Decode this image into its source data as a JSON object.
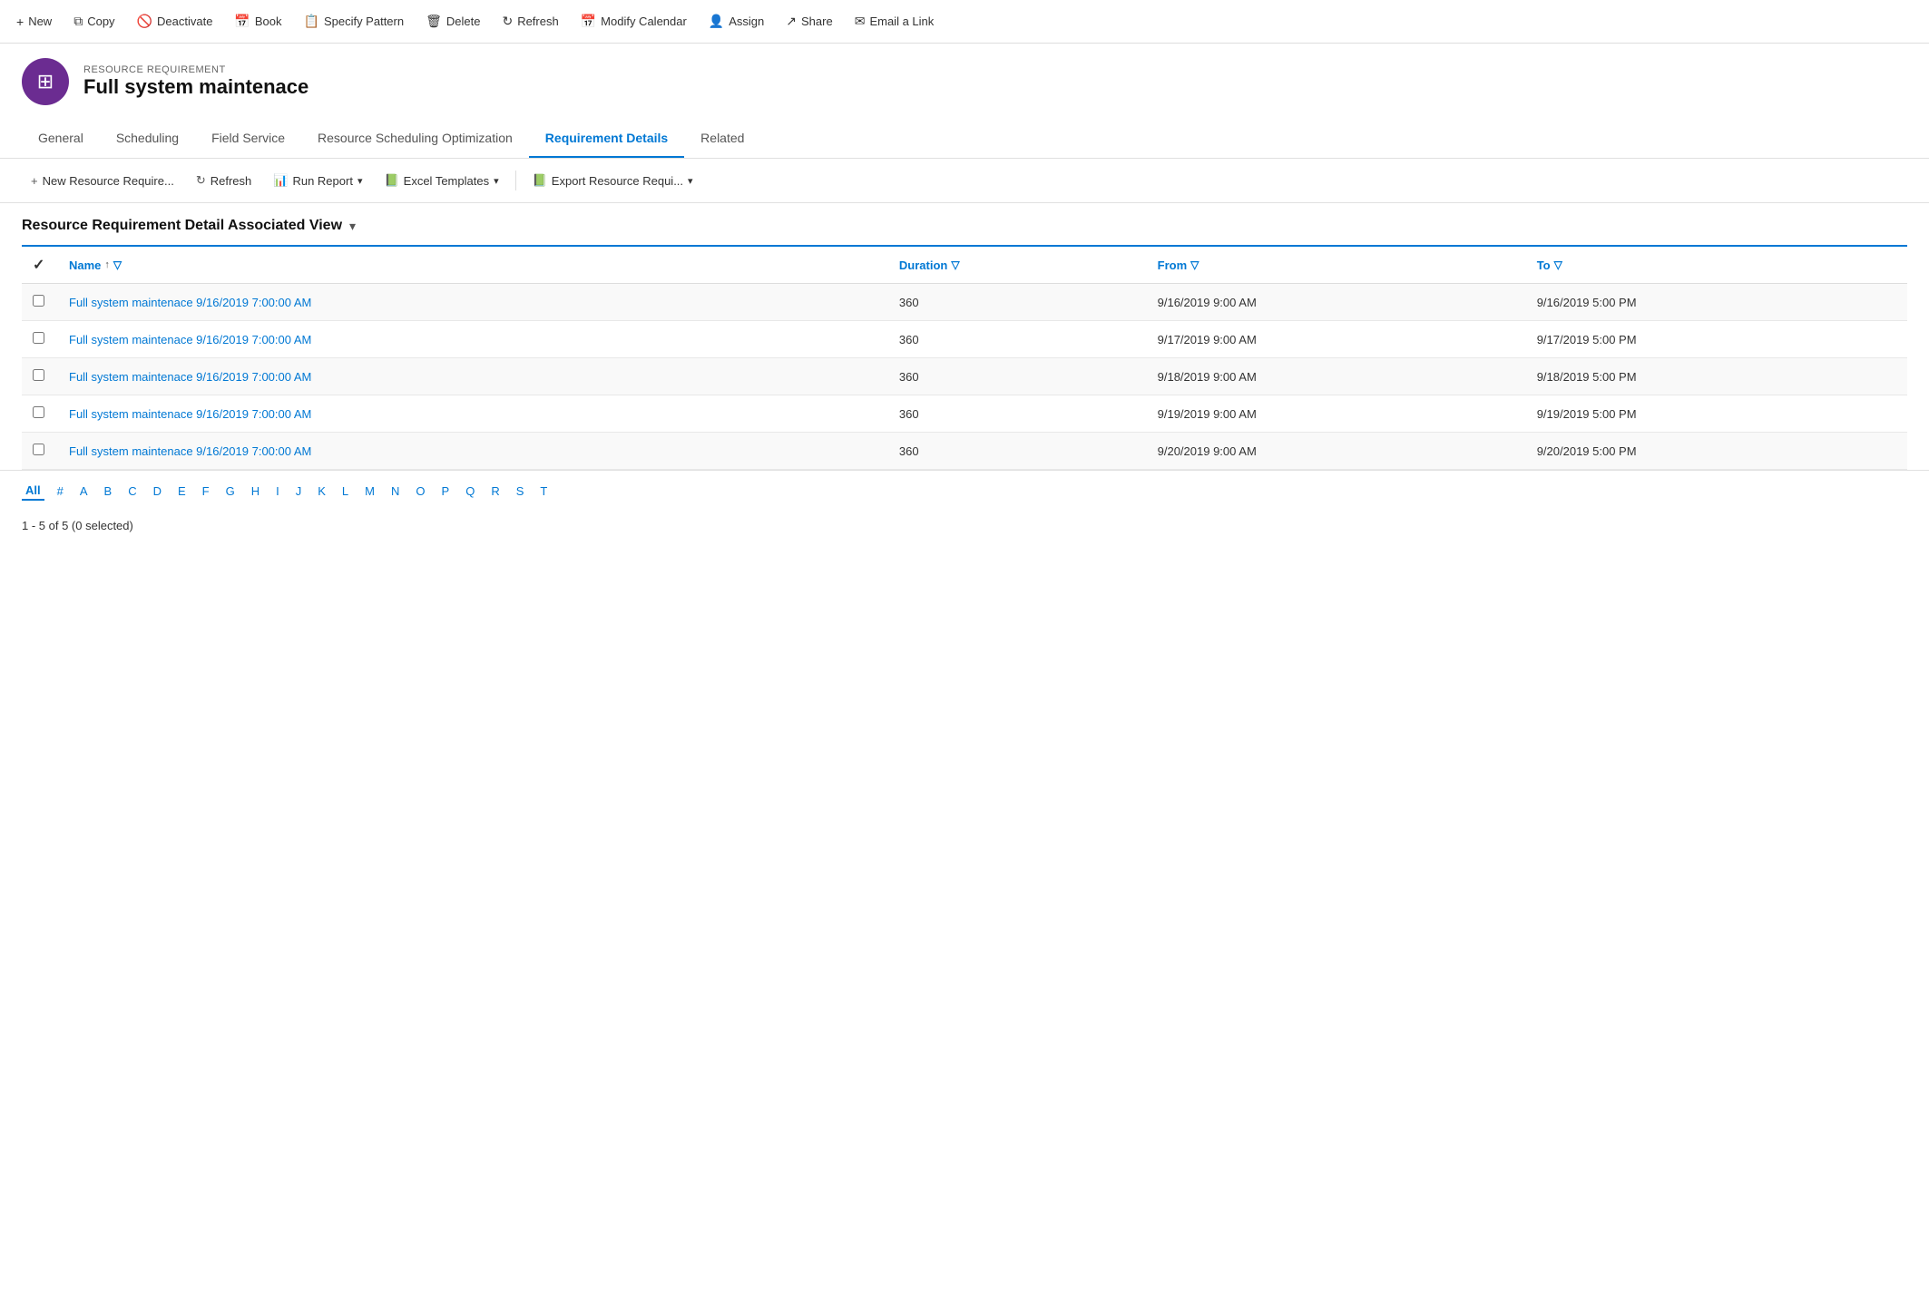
{
  "toolbar": {
    "buttons": [
      {
        "id": "new",
        "label": "New",
        "icon": "+"
      },
      {
        "id": "copy",
        "label": "Copy",
        "icon": "⧉"
      },
      {
        "id": "deactivate",
        "label": "Deactivate",
        "icon": "🚫"
      },
      {
        "id": "book",
        "label": "Book",
        "icon": "📅"
      },
      {
        "id": "specify-pattern",
        "label": "Specify Pattern",
        "icon": "📋"
      },
      {
        "id": "delete",
        "label": "Delete",
        "icon": "🗑"
      },
      {
        "id": "refresh",
        "label": "Refresh",
        "icon": "↻"
      },
      {
        "id": "modify-calendar",
        "label": "Modify Calendar",
        "icon": "📅"
      },
      {
        "id": "assign",
        "label": "Assign",
        "icon": "👤"
      },
      {
        "id": "share",
        "label": "Share",
        "icon": "↗"
      },
      {
        "id": "email-a-link",
        "label": "Email a Link",
        "icon": "✉"
      }
    ]
  },
  "record": {
    "type": "RESOURCE REQUIREMENT",
    "title": "Full system maintenace",
    "avatar_icon": "⊞"
  },
  "tabs": [
    {
      "id": "general",
      "label": "General",
      "active": false
    },
    {
      "id": "scheduling",
      "label": "Scheduling",
      "active": false
    },
    {
      "id": "field-service",
      "label": "Field Service",
      "active": false
    },
    {
      "id": "resource-scheduling-optimization",
      "label": "Resource Scheduling Optimization",
      "active": false
    },
    {
      "id": "requirement-details",
      "label": "Requirement Details",
      "active": true
    },
    {
      "id": "related",
      "label": "Related",
      "active": false
    }
  ],
  "sub_toolbar": {
    "buttons": [
      {
        "id": "new-resource-require",
        "label": "New Resource Require...",
        "icon": "+"
      },
      {
        "id": "refresh",
        "label": "Refresh",
        "icon": "↻"
      },
      {
        "id": "run-report",
        "label": "Run Report",
        "icon": "📊",
        "has_dropdown": true
      },
      {
        "id": "excel-templates",
        "label": "Excel Templates",
        "icon": "📗",
        "has_dropdown": true
      },
      {
        "id": "export-resource-requi",
        "label": "Export Resource Requi...",
        "icon": "📗",
        "has_dropdown": true
      }
    ]
  },
  "view_title": "Resource Requirement Detail Associated View",
  "table": {
    "columns": [
      {
        "id": "name",
        "label": "Name",
        "has_sort": true,
        "has_filter": true
      },
      {
        "id": "duration",
        "label": "Duration",
        "has_sort": false,
        "has_filter": true
      },
      {
        "id": "from",
        "label": "From",
        "has_sort": false,
        "has_filter": true
      },
      {
        "id": "to",
        "label": "To",
        "has_sort": false,
        "has_filter": true
      }
    ],
    "rows": [
      {
        "name": "Full system maintenace 9/16/2019 7:00:00 AM",
        "duration": "360",
        "from": "9/16/2019 9:00 AM",
        "to": "9/16/2019 5:00 PM"
      },
      {
        "name": "Full system maintenace 9/16/2019 7:00:00 AM",
        "duration": "360",
        "from": "9/17/2019 9:00 AM",
        "to": "9/17/2019 5:00 PM"
      },
      {
        "name": "Full system maintenace 9/16/2019 7:00:00 AM",
        "duration": "360",
        "from": "9/18/2019 9:00 AM",
        "to": "9/18/2019 5:00 PM"
      },
      {
        "name": "Full system maintenace 9/16/2019 7:00:00 AM",
        "duration": "360",
        "from": "9/19/2019 9:00 AM",
        "to": "9/19/2019 5:00 PM"
      },
      {
        "name": "Full system maintenace 9/16/2019 7:00:00 AM",
        "duration": "360",
        "from": "9/20/2019 9:00 AM",
        "to": "9/20/2019 5:00 PM"
      }
    ]
  },
  "alphabet": [
    "All",
    "#",
    "A",
    "B",
    "C",
    "D",
    "E",
    "F",
    "G",
    "H",
    "I",
    "J",
    "K",
    "L",
    "M",
    "N",
    "O",
    "P",
    "Q",
    "R",
    "S",
    "T"
  ],
  "record_count": "1 - 5 of 5 (0 selected)"
}
